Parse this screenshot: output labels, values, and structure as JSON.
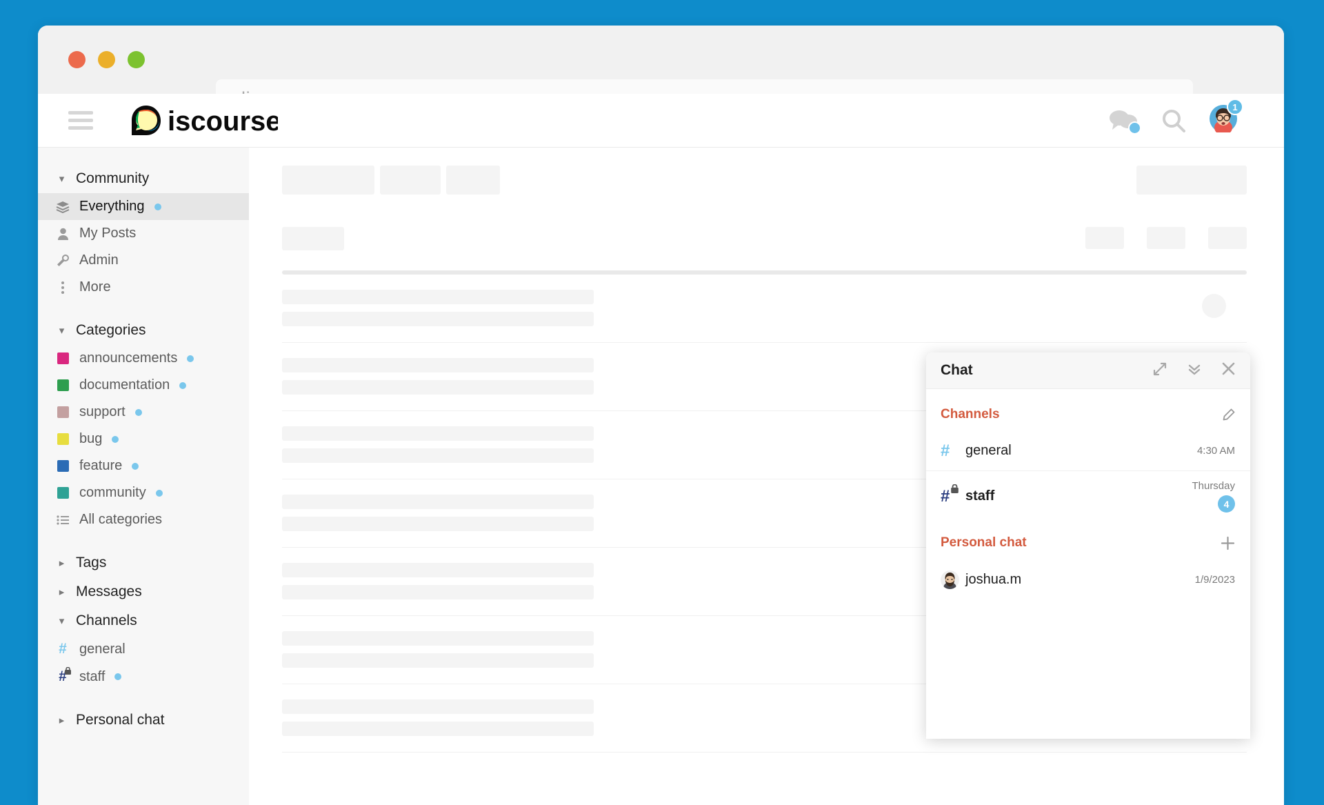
{
  "browser": {
    "url": "discourse.org",
    "traffic_lights": [
      "close-red",
      "minimize-yellow",
      "maximize-green"
    ]
  },
  "header": {
    "menu_icon": "hamburger-icon",
    "logo_text": "Discourse",
    "chat_icon": "chat-bubble-icon",
    "search_icon": "search-icon",
    "avatar_icon": "user-avatar",
    "avatar_badge": "1"
  },
  "sidebar": {
    "sections": [
      {
        "title": "Community",
        "expanded": true,
        "chevron": "chevron-down-icon",
        "items": [
          {
            "label": "Everything",
            "icon": "layers-icon",
            "active": true,
            "unread": true
          },
          {
            "label": "My Posts",
            "icon": "user-icon",
            "active": false,
            "unread": false
          },
          {
            "label": "Admin",
            "icon": "wrench-icon",
            "active": false,
            "unread": false
          },
          {
            "label": "More",
            "icon": "dots-vertical-icon",
            "active": false,
            "unread": false
          }
        ]
      },
      {
        "title": "Categories",
        "expanded": true,
        "chevron": "chevron-down-icon",
        "items": [
          {
            "label": "announcements",
            "icon": "category-swatch",
            "color": "#D9277F",
            "unread": true
          },
          {
            "label": "documentation",
            "icon": "category-swatch",
            "color": "#2E9E4F",
            "unread": true
          },
          {
            "label": "support",
            "icon": "category-swatch",
            "color": "#C3A0A0",
            "unread": true
          },
          {
            "label": "bug",
            "icon": "category-swatch",
            "color": "#E7DD3F",
            "unread": true
          },
          {
            "label": "feature",
            "icon": "category-swatch",
            "color": "#2B6CB5",
            "unread": true
          },
          {
            "label": "community",
            "icon": "category-swatch",
            "color": "#2FA295",
            "unread": true
          },
          {
            "label": "All categories",
            "icon": "list-icon",
            "color": "",
            "unread": false
          }
        ]
      },
      {
        "title": "Tags",
        "expanded": false,
        "chevron": "chevron-right-icon",
        "items": []
      },
      {
        "title": "Messages",
        "expanded": false,
        "chevron": "chevron-right-icon",
        "items": []
      },
      {
        "title": "Channels",
        "expanded": true,
        "chevron": "chevron-down-icon",
        "items": [
          {
            "label": "general",
            "icon": "hash-icon",
            "unread": false
          },
          {
            "label": "staff",
            "icon": "hash-lock-icon",
            "unread": true
          }
        ]
      },
      {
        "title": "Personal chat",
        "expanded": false,
        "chevron": "chevron-right-icon",
        "items": []
      }
    ]
  },
  "chat_drawer": {
    "title": "Chat",
    "actions": [
      {
        "name": "expand-icon"
      },
      {
        "name": "collapse-chevrons-icon"
      },
      {
        "name": "close-icon"
      }
    ],
    "groups": [
      {
        "title": "Channels",
        "action_icon": "pencil-icon",
        "rows": [
          {
            "name": "general",
            "icon": "hash-icon",
            "time": "4:30 AM",
            "badge": "",
            "bold": false
          },
          {
            "name": "staff",
            "icon": "hash-lock-icon",
            "time": "Thursday",
            "badge": "4",
            "bold": true
          }
        ]
      },
      {
        "title": "Personal chat",
        "action_icon": "plus-icon",
        "rows": [
          {
            "name": "joshua.m",
            "icon": "user-avatar",
            "time": "1/9/2023",
            "badge": "",
            "bold": false
          }
        ]
      }
    ]
  },
  "colors": {
    "page_background": "#0E8CCB",
    "accent": "#D35A3E",
    "unread_dot": "#7AC7EC",
    "badge": "#6FC1EA"
  }
}
